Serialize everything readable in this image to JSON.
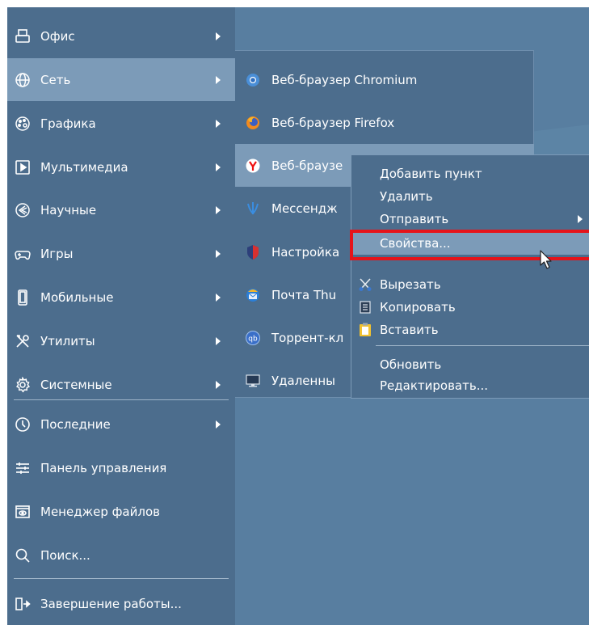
{
  "colors": {
    "desktop": "#587ea0",
    "menu": "#4c6d8d",
    "selected": "#7c9bb8",
    "highlight": "#e5141a"
  },
  "main_menu": {
    "items": [
      {
        "label": "Офис",
        "icon": "office-icon",
        "has_submenu": true
      },
      {
        "label": "Сеть",
        "icon": "globe-icon",
        "has_submenu": true,
        "selected": true
      },
      {
        "label": "Графика",
        "icon": "palette-icon",
        "has_submenu": true
      },
      {
        "label": "Мультимедиа",
        "icon": "play-icon",
        "has_submenu": true
      },
      {
        "label": "Научные",
        "icon": "science-icon",
        "has_submenu": true
      },
      {
        "label": "Игры",
        "icon": "gamepad-icon",
        "has_submenu": true
      },
      {
        "label": "Мобильные",
        "icon": "phone-icon",
        "has_submenu": true
      },
      {
        "label": "Утилиты",
        "icon": "tools-icon",
        "has_submenu": true
      },
      {
        "label": "Системные",
        "icon": "gear-icon",
        "has_submenu": true
      }
    ],
    "bottom_items": [
      {
        "label": "Последние",
        "icon": "clock-icon",
        "has_submenu": true
      },
      {
        "label": "Панель управления",
        "icon": "sliders-icon"
      },
      {
        "label": "Менеджер файлов",
        "icon": "file-manager-icon"
      },
      {
        "label": "Поиск...",
        "icon": "search-icon"
      }
    ],
    "shutdown": {
      "label": "Завершение работы...",
      "icon": "logout-icon"
    }
  },
  "network_submenu": {
    "items": [
      {
        "label": "Веб-браузер Chromium",
        "icon": "chromium-icon"
      },
      {
        "label": "Веб-браузер Firefox",
        "icon": "firefox-icon"
      },
      {
        "label": "Веб-браузе",
        "icon": "yandex-browser-icon",
        "selected": true
      },
      {
        "label": "Мессендж",
        "icon": "messenger-icon"
      },
      {
        "label": "Настройка",
        "icon": "shield-icon"
      },
      {
        "label": "Почта Thu",
        "icon": "thunderbird-icon"
      },
      {
        "label": "Торрент-кл",
        "icon": "qbittorrent-icon"
      },
      {
        "label": "Удаленны",
        "icon": "remote-desktop-icon"
      }
    ]
  },
  "context_menu": {
    "add_item": "Добавить пункт",
    "delete": "Удалить",
    "send": "Отправить",
    "properties": "Свойства...",
    "cut": "Вырезать",
    "copy": "Копировать",
    "paste": "Вставить",
    "refresh": "Обновить",
    "edit": "Редактировать..."
  }
}
